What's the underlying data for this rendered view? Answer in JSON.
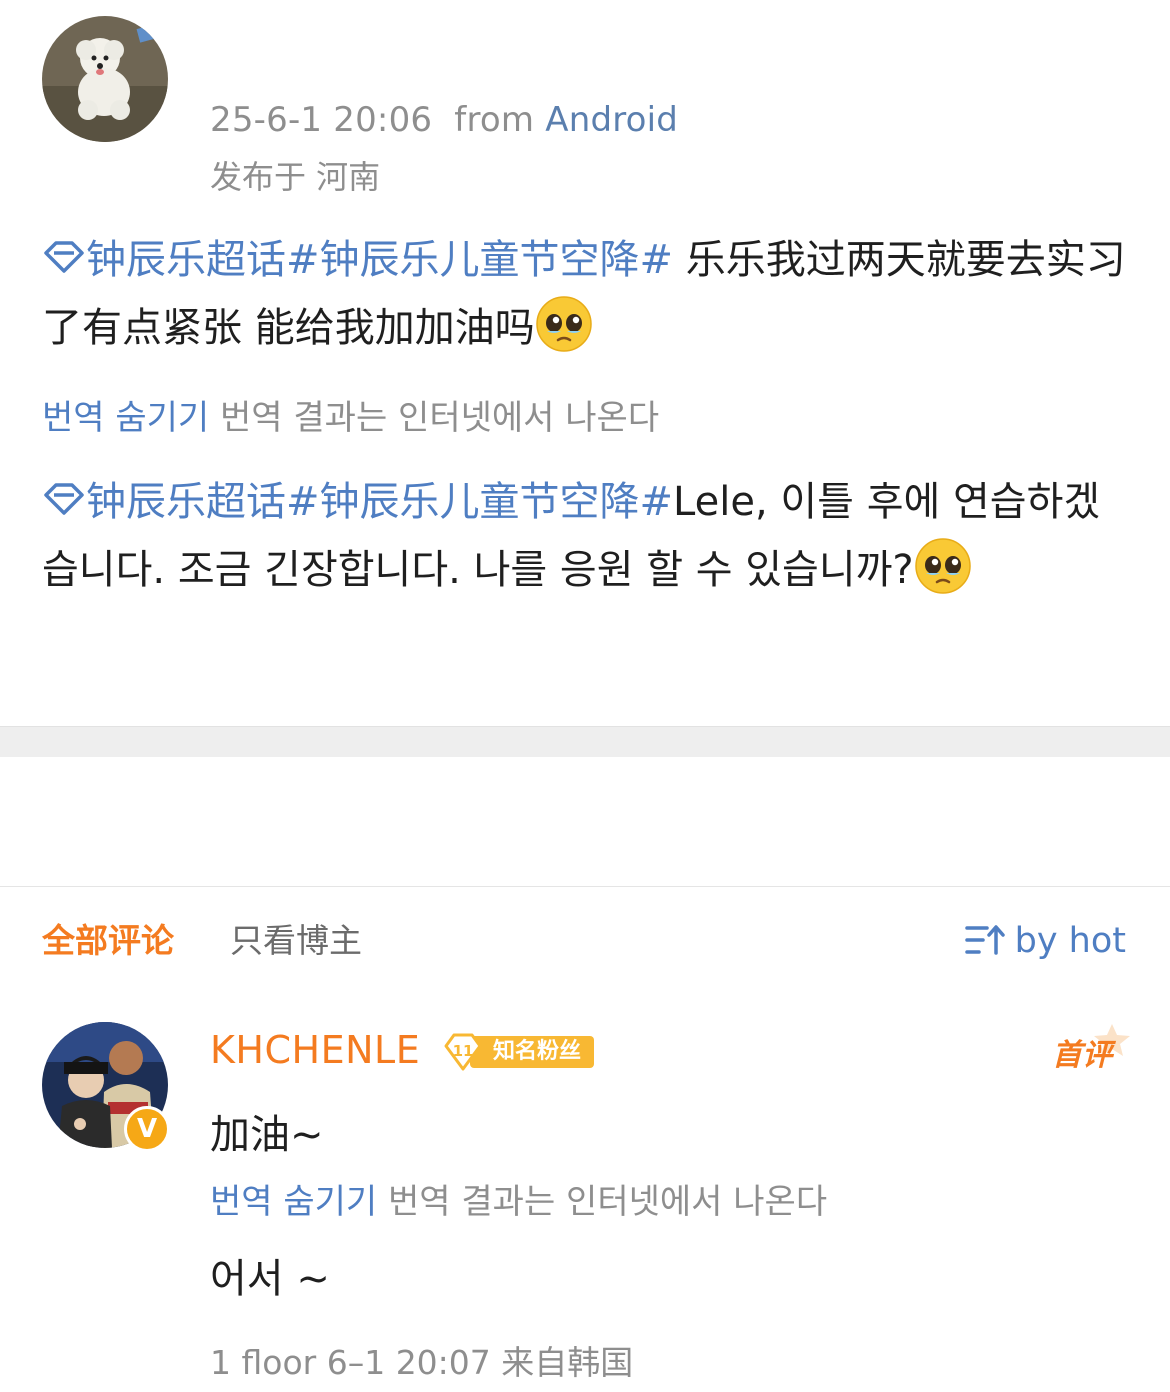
{
  "post": {
    "timestamp": "25-6-1 20:06",
    "from_prefix": "from",
    "from_source": "Android",
    "location": "发布于 河南",
    "original": {
      "tags": "钟辰乐超话#钟辰乐儿童节空降#",
      "body": " 乐乐我过两天就要去实习了有点紧张 能给我加加油吗"
    },
    "translate": {
      "hide_label": "번역 숨기기",
      "notice": "번역 결과는 인터넷에서 나온다"
    },
    "translated": {
      "tags": "钟辰乐超话#钟辰乐儿童节空降#",
      "body": "Lele, 이틀 후에 연습하겠습니다. 조금 긴장합니다. 나를 응원 할 수 있습니까?"
    }
  },
  "comments_section": {
    "tab_all": "全部评论",
    "tab_host_only": "只看博主",
    "sort_label": "by hot"
  },
  "comment": {
    "username": "KHCHENLE",
    "fan_level": "11",
    "fan_label": "知名粉丝",
    "first_review": "首评",
    "text": "加油~",
    "translate": {
      "hide_label": "번역 숨기기",
      "notice": "번역 결과는 인터넷에서 나온다"
    },
    "translated_text": "어서 ~",
    "footer": "1 floor 6–1 20:07  来自韩国",
    "verified_mark": "V"
  },
  "colors": {
    "link_blue": "#4f7ec2",
    "accent_orange": "#f47b20",
    "meta_gray": "#8e8e8e",
    "badge_gold": "#f8b833"
  },
  "icons": {
    "tag": "super-topic-diamond-icon",
    "emoji": "pleading-face-emoji",
    "sort": "sort-icon",
    "verified": "verified-badge-icon"
  }
}
